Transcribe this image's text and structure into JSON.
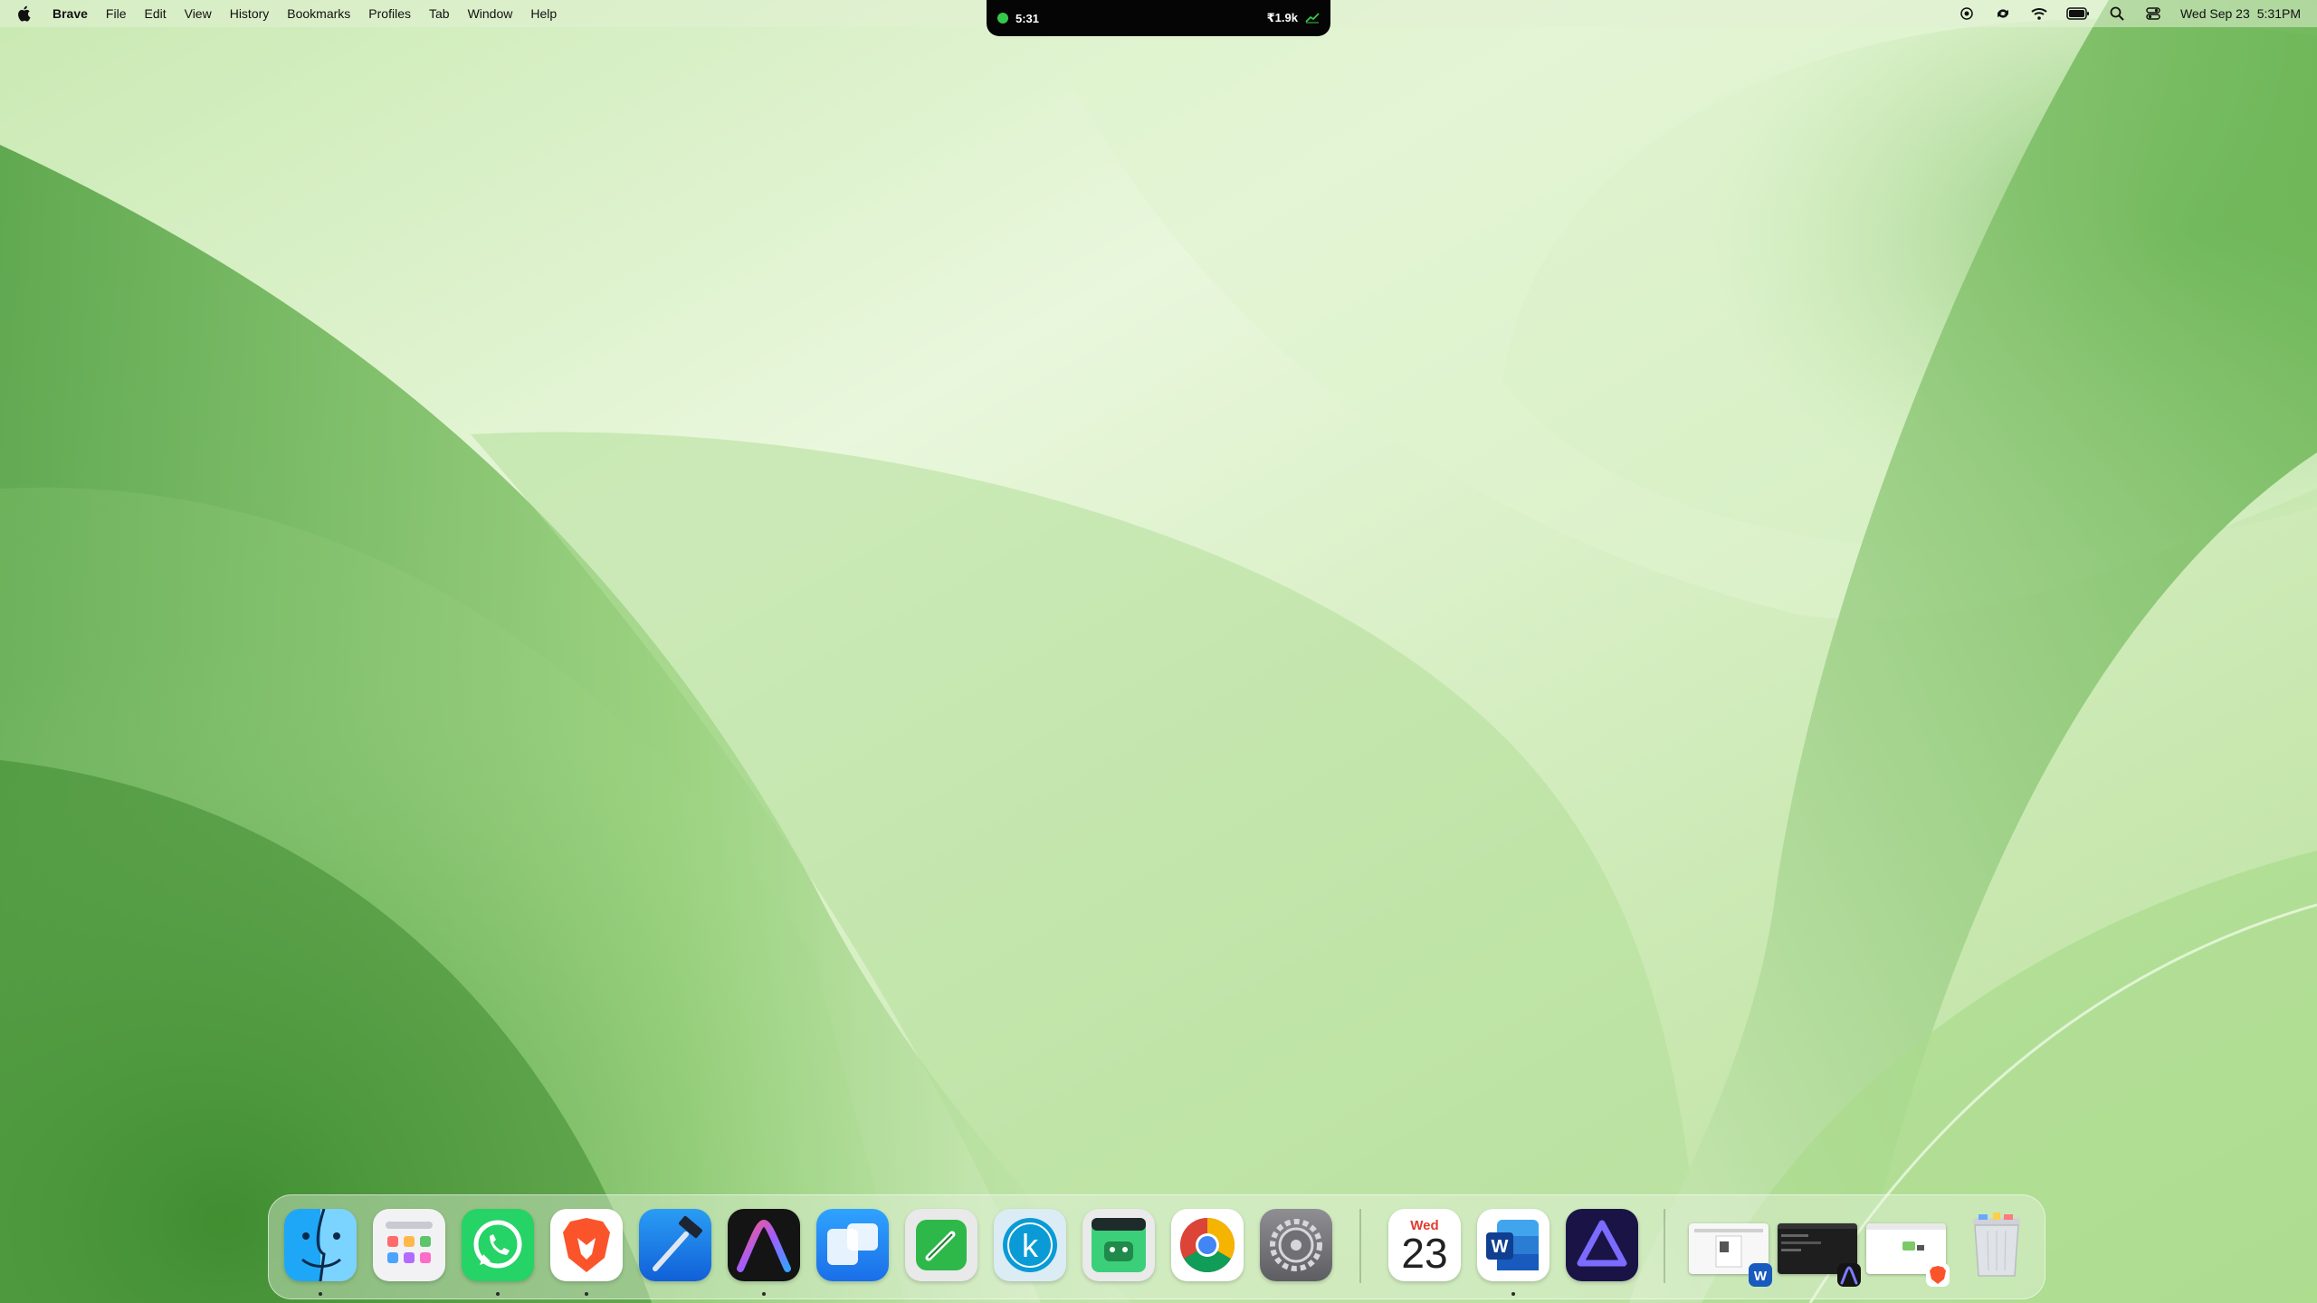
{
  "menubar": {
    "app_name": "Brave",
    "menus": [
      "File",
      "Edit",
      "View",
      "History",
      "Bookmarks",
      "Profiles",
      "Tab",
      "Window",
      "Help"
    ],
    "status_icons": [
      "screen-record-icon",
      "sync-icon",
      "wifi-icon",
      "battery-icon",
      "spotlight-search-icon",
      "control-center-icon"
    ],
    "date": "Wed Sep 23",
    "time": "5:31PM"
  },
  "notch": {
    "timer": "5:31",
    "stat": "₹1.9k",
    "timer_icon": "green-dot-icon",
    "stat_icon": "chart-up-icon"
  },
  "dock": {
    "apps": [
      {
        "name": "Finder",
        "icon": "finder-icon",
        "running": true
      },
      {
        "name": "Launchpad",
        "icon": "launchpad-icon",
        "running": false
      },
      {
        "name": "WhatsApp",
        "icon": "whatsapp-icon",
        "running": true
      },
      {
        "name": "Brave Browser",
        "icon": "brave-icon",
        "running": true
      },
      {
        "name": "Xcode",
        "icon": "xcode-icon",
        "running": false
      },
      {
        "name": "Arc-style Browser",
        "icon": "a-browser-icon",
        "running": true
      },
      {
        "name": "Screens App",
        "icon": "blue-windows-icon",
        "running": false
      },
      {
        "name": "Pencil App",
        "icon": "green-pencil-icon",
        "running": false
      },
      {
        "name": "K App",
        "icon": "k-icon",
        "running": false
      },
      {
        "name": "Android Emulator",
        "icon": "android-terminal-icon",
        "running": false
      },
      {
        "name": "Google Chrome",
        "icon": "chrome-icon",
        "running": false
      },
      {
        "name": "System Settings",
        "icon": "settings-gear-icon",
        "running": false
      }
    ],
    "recent_apps": [
      {
        "name": "Calendar",
        "icon": "calendar-icon",
        "day": "Wed",
        "date": "23",
        "running": false
      },
      {
        "name": "Microsoft Word",
        "icon": "word-icon",
        "running": true
      },
      {
        "name": "Affinity Designer",
        "icon": "affinity-icon",
        "running": false
      }
    ],
    "minimized_windows": [
      {
        "name": "Word Document Window",
        "badge": "word-icon"
      },
      {
        "name": "Editor Window",
        "badge": "a-browser-icon"
      },
      {
        "name": "Brave Window",
        "badge": "brave-icon"
      }
    ],
    "trash": {
      "name": "Trash",
      "icon": "trash-icon"
    }
  },
  "colors": {
    "wallpaper_light": "#e6f5d6",
    "wallpaper_mid": "#a6d98a",
    "wallpaper_dark": "#4a9a3a",
    "notch_bg": "#050505",
    "accent_green": "#36c84a"
  }
}
